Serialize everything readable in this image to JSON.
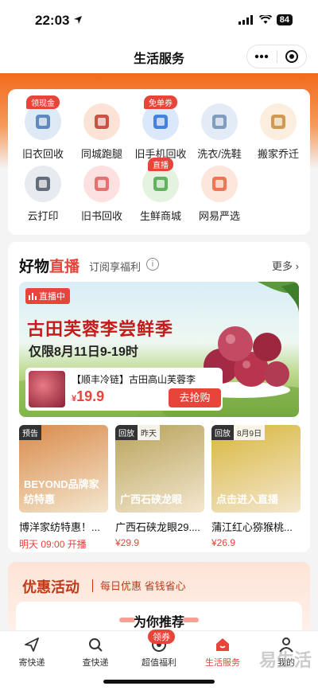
{
  "status_bar": {
    "time": "22:03",
    "battery": "84"
  },
  "nav": {
    "title": "生活服务"
  },
  "services": [
    {
      "label": "旧衣回收",
      "badge": "领现金",
      "color": "#dfe9f5",
      "accent": "#4a78b4"
    },
    {
      "label": "同城跑腿",
      "badge": "",
      "color": "#fbe3d5",
      "accent": "#c0392b"
    },
    {
      "label": "旧手机回收",
      "badge": "免单券",
      "color": "#dbe8fb",
      "accent": "#2a6ed8"
    },
    {
      "label": "洗衣/洗鞋",
      "badge": "",
      "color": "#e3ecf6",
      "accent": "#6f8fb5"
    },
    {
      "label": "搬家乔迁",
      "badge": "",
      "color": "#fbeede",
      "accent": "#c9893a"
    },
    {
      "label": "云打印",
      "badge": "",
      "color": "#e7ebf0",
      "accent": "#4c5766"
    },
    {
      "label": "旧书回收",
      "badge": "",
      "color": "#fde1e1",
      "accent": "#e25a5a"
    },
    {
      "label": "生鲜商城",
      "badge": "直播",
      "color": "#e3f3df",
      "accent": "#4ea54b"
    },
    {
      "label": "网易严选",
      "badge": "",
      "color": "#fde7dc",
      "accent": "#e7643a"
    }
  ],
  "live": {
    "title_prefix": "好物",
    "title_highlight": "直播",
    "subtitle": "订阅享福利",
    "more": "更多",
    "banner": {
      "tag": "直播中",
      "title": "古田芙蓉李尝鲜季",
      "subtitle": "仅限8月11日9-19时",
      "product_name": "【顺丰冷链】古田高山芙蓉李",
      "currency": "¥",
      "price": "19.9",
      "buy_label": "去抢购"
    },
    "minis": [
      {
        "tag1": "预告",
        "tag2": "",
        "img_text": "BEYOND品牌家纺特惠",
        "title": "博洋家纺特惠！...",
        "price": "明天 09:00 开播",
        "bg": "#d98a4a"
      },
      {
        "tag1": "回放",
        "tag2": "昨天",
        "img_text": "广西石硖龙眼",
        "title": "广西石硖龙眼29....",
        "price": "¥29.9",
        "bg": "#b7a25a"
      },
      {
        "tag1": "回放",
        "tag2": "8月9日",
        "img_text": "点击进入直播",
        "title": "蒲江红心猕猴桃...",
        "price": "¥26.9",
        "bg": "#d8b63c"
      }
    ]
  },
  "promo": {
    "title": "优惠活动",
    "subtitle": "每日优惠  省钱省心",
    "recommend": "为你推荐"
  },
  "tabs": [
    {
      "label": "寄快递",
      "icon": "send-icon",
      "active": false
    },
    {
      "label": "查快递",
      "icon": "search-icon",
      "active": false
    },
    {
      "label": "超值福利",
      "icon": "gift-icon",
      "active": false,
      "badge": "领券"
    },
    {
      "label": "生活服务",
      "icon": "home-icon",
      "active": true
    },
    {
      "label": "我的",
      "icon": "user-icon",
      "active": false
    }
  ],
  "colors": {
    "accent": "#e7443a",
    "header_orange": "#f26a1b"
  }
}
